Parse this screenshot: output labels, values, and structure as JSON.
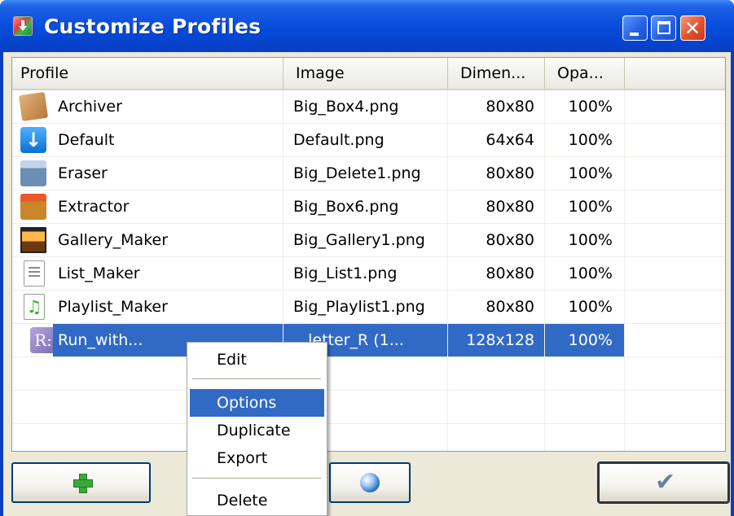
{
  "window": {
    "title": "Customize Profiles"
  },
  "columns": {
    "profile": "Profile",
    "image": "Image",
    "dimensions": "Dimen...",
    "opacity": "Opa..."
  },
  "rows": [
    {
      "profile": "Archiver",
      "image": "Big_Box4.png",
      "dimensions": "80x80",
      "opacity": "100%",
      "icon": "box-icon"
    },
    {
      "profile": "Default",
      "image": "Default.png",
      "dimensions": "64x64",
      "opacity": "100%",
      "icon": "download-arrow-icon"
    },
    {
      "profile": "Eraser",
      "image": "Big_Delete1.png",
      "dimensions": "80x80",
      "opacity": "100%",
      "icon": "trash-icon"
    },
    {
      "profile": "Extractor",
      "image": "Big_Box6.png",
      "dimensions": "80x80",
      "opacity": "100%",
      "icon": "open-box-icon"
    },
    {
      "profile": "Gallery_Maker",
      "image": "Big_Gallery1.png",
      "dimensions": "80x80",
      "opacity": "100%",
      "icon": "gallery-icon"
    },
    {
      "profile": "List_Maker",
      "image": "Big_List1.png",
      "dimensions": "80x80",
      "opacity": "100%",
      "icon": "list-icon"
    },
    {
      "profile": "Playlist_Maker",
      "image": "Big_Playlist1.png",
      "dimensions": "80x80",
      "opacity": "100%",
      "icon": "music-note-icon"
    },
    {
      "profile": "Run_with...",
      "image": "...letter_R (1...",
      "dimensions": "128x128",
      "opacity": "100%",
      "icon": "letter-r-icon",
      "selected": true
    }
  ],
  "context_menu": {
    "items": [
      "Edit",
      "Options",
      "Duplicate",
      "Export",
      "Delete"
    ],
    "highlighted": "Options"
  },
  "icons": {
    "app": "download-arrow-icon",
    "add_button": "plus-icon",
    "browse_button": "globe-magnifier-icon",
    "ok_button": "checkmark-icon"
  },
  "colors": {
    "titlebar": "#0a4fde",
    "selection": "#316ac5",
    "close_button": "#e2522c"
  }
}
